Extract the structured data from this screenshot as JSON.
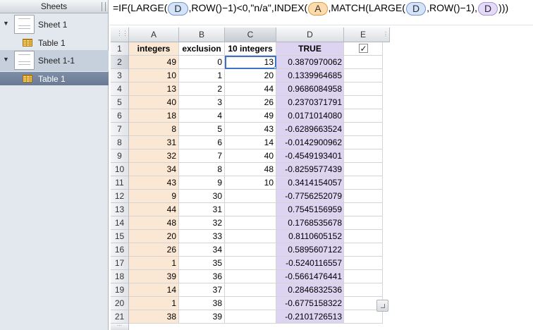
{
  "sidebar": {
    "title": "Sheets",
    "sheets": [
      {
        "label": "Sheet 1",
        "table": "Table 1"
      },
      {
        "label": "Sheet 1-1",
        "table": "Table 1"
      }
    ]
  },
  "formula": {
    "p1": "=IF(LARGE(",
    "t1": "D",
    "p2": ",ROW()−1)<0,\"n/a\",INDEX(",
    "t2": "A",
    "p3": ",MATCH(LARGE(",
    "t3": "D",
    "p4": ",ROW()−1),",
    "t4": "D",
    "p5": ")))"
  },
  "columns": [
    "A",
    "B",
    "C",
    "D",
    "E"
  ],
  "header_row": {
    "A": "integers",
    "B": "exclusion",
    "C": "10 integers",
    "D": "TRUE",
    "E_checked": true
  },
  "rows": [
    {
      "n": "2",
      "A": "49",
      "B": "0",
      "C": "13",
      "D": "0.3870970062"
    },
    {
      "n": "3",
      "A": "10",
      "B": "1",
      "C": "20",
      "D": "0.1339964685"
    },
    {
      "n": "4",
      "A": "13",
      "B": "2",
      "C": "44",
      "D": "0.9686084958"
    },
    {
      "n": "5",
      "A": "40",
      "B": "3",
      "C": "26",
      "D": "0.2370371791"
    },
    {
      "n": "6",
      "A": "18",
      "B": "4",
      "C": "49",
      "D": "0.0171014080"
    },
    {
      "n": "7",
      "A": "8",
      "B": "5",
      "C": "43",
      "D": "-0.6289663524"
    },
    {
      "n": "8",
      "A": "31",
      "B": "6",
      "C": "14",
      "D": "-0.0142900962"
    },
    {
      "n": "9",
      "A": "32",
      "B": "7",
      "C": "40",
      "D": "-0.4549193401"
    },
    {
      "n": "10",
      "A": "34",
      "B": "8",
      "C": "48",
      "D": "-0.8259577439"
    },
    {
      "n": "11",
      "A": "43",
      "B": "9",
      "C": "10",
      "D": "0.3414154057"
    },
    {
      "n": "12",
      "A": "9",
      "B": "30",
      "C": "",
      "D": "-0.7756252079"
    },
    {
      "n": "13",
      "A": "44",
      "B": "31",
      "C": "",
      "D": "0.7545156959"
    },
    {
      "n": "14",
      "A": "48",
      "B": "32",
      "C": "",
      "D": "0.1768535678"
    },
    {
      "n": "15",
      "A": "20",
      "B": "33",
      "C": "",
      "D": "0.8110605152"
    },
    {
      "n": "16",
      "A": "26",
      "B": "34",
      "C": "",
      "D": "0.5895607122"
    },
    {
      "n": "17",
      "A": "1",
      "B": "35",
      "C": "",
      "D": "-0.5240116557"
    },
    {
      "n": "18",
      "A": "39",
      "B": "36",
      "C": "",
      "D": "-0.5661476441"
    },
    {
      "n": "19",
      "A": "14",
      "B": "37",
      "C": "",
      "D": "0.2846832536"
    },
    {
      "n": "20",
      "A": "1",
      "B": "38",
      "C": "",
      "D": "-0.6775158322"
    },
    {
      "n": "21",
      "A": "38",
      "B": "39",
      "C": "",
      "D": "-0.2101726513"
    }
  ],
  "selection": {
    "column": "C",
    "row": "2"
  },
  "colors": {
    "col_a_fill": "#fbe8d4",
    "col_d_fill": "#ddd4f1",
    "selection": "#3d72c9"
  }
}
